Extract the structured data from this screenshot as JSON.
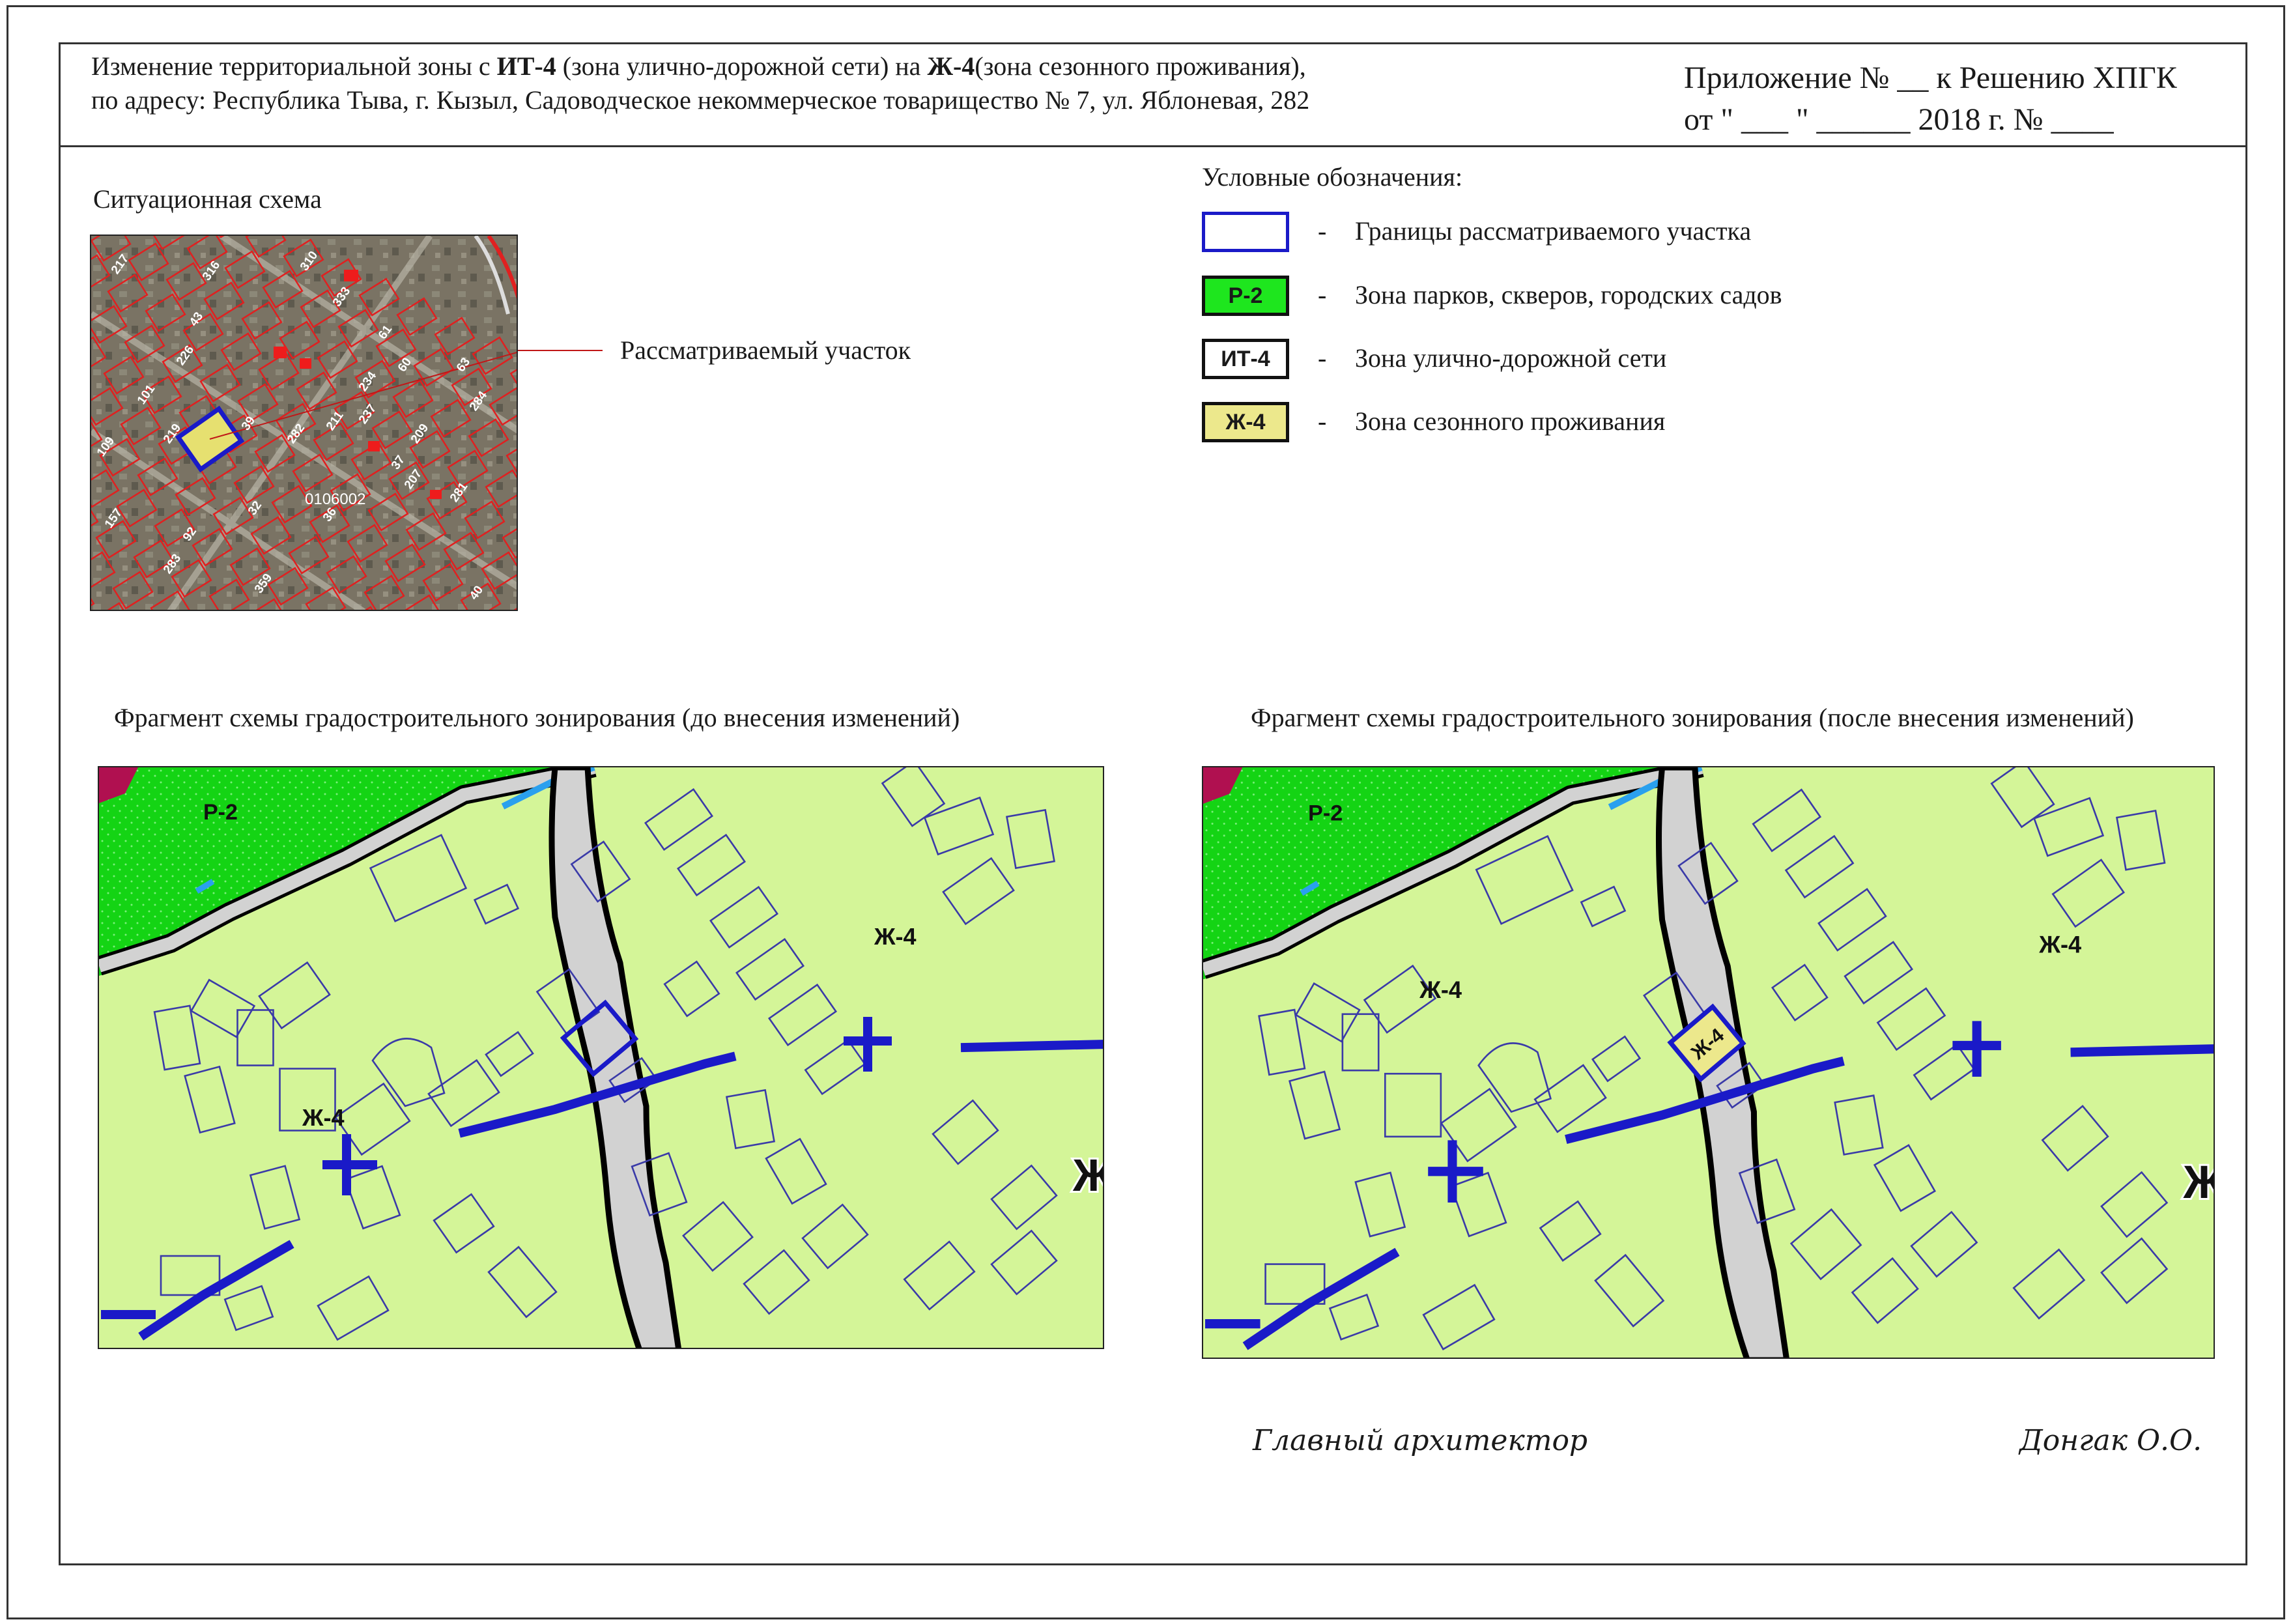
{
  "header": {
    "title_line1_prefix": "Изменение территориальной зоны с ",
    "from_zone": "ИТ-4",
    "title_line1_mid": " (зона улично-дорожной сети) на ",
    "to_zone": "Ж-4",
    "title_line1_suffix": "(зона сезонного проживания),",
    "title_line2": "по адресу: Республика Тыва, г. Кызыл, Садоводческое некоммерческое товарищество № 7, ул. Яблоневая, 282",
    "appendix_line1": "Приложение № __ к Решению ХПГК",
    "appendix_line2": "от \" ___ \" ______ 2018 г. № ____"
  },
  "situation": {
    "caption": "Ситуационная схема",
    "callout": "Рассматриваемый участок",
    "block_label": "0106002",
    "lot_labels": [
      "217",
      "316",
      "310",
      "333",
      "101",
      "226",
      "61",
      "219",
      "234",
      "60",
      "63",
      "209",
      "237",
      "109",
      "281",
      "207",
      "157",
      "283",
      "359",
      "211",
      "282",
      "32",
      "36",
      "40",
      "92",
      "39",
      "284",
      "43",
      "37"
    ]
  },
  "legend": {
    "title": "Условные обозначения:",
    "items": [
      {
        "code": "",
        "fill": "#ffffff",
        "border": "#1a1ac8",
        "text": "Границы рассматриваемого участка"
      },
      {
        "code": "Р-2",
        "fill": "#1ee61e",
        "border": "#111111",
        "text": "Зона парков, скверов, городских садов"
      },
      {
        "code": "ИТ-4",
        "fill": "#ffffff",
        "border": "#111111",
        "text": "Зона улично-дорожной сети"
      },
      {
        "code": "Ж-4",
        "fill": "#ece88c",
        "border": "#111111",
        "text": "Зона сезонного проживания"
      }
    ],
    "dash": "-"
  },
  "maps": {
    "before_caption": "Фрагмент схемы градостроительного зонирования (до внесения изменений)",
    "after_caption": "Фрагмент схемы градостроительного зонирования (после внесения изменений)",
    "before_labels": {
      "park": "Р-2",
      "res_right": "Ж-4",
      "res_left": "Ж-4",
      "res_edge": "Ж"
    },
    "after_labels": {
      "park": "Р-2",
      "res_right": "Ж-4",
      "res_left": "Ж-4",
      "res_edge": "Ж",
      "parcel": "Ж-4"
    }
  },
  "colors": {
    "residential": "#d4f598",
    "park": "#14d414",
    "road": "#d2d2d2",
    "boundary": "#1a1ac8",
    "parcel_lines": "#3a3aa8",
    "selected_fill": "#ece88c"
  },
  "signature": {
    "position": "Главный архитектор",
    "name": "Донгак О.О."
  }
}
